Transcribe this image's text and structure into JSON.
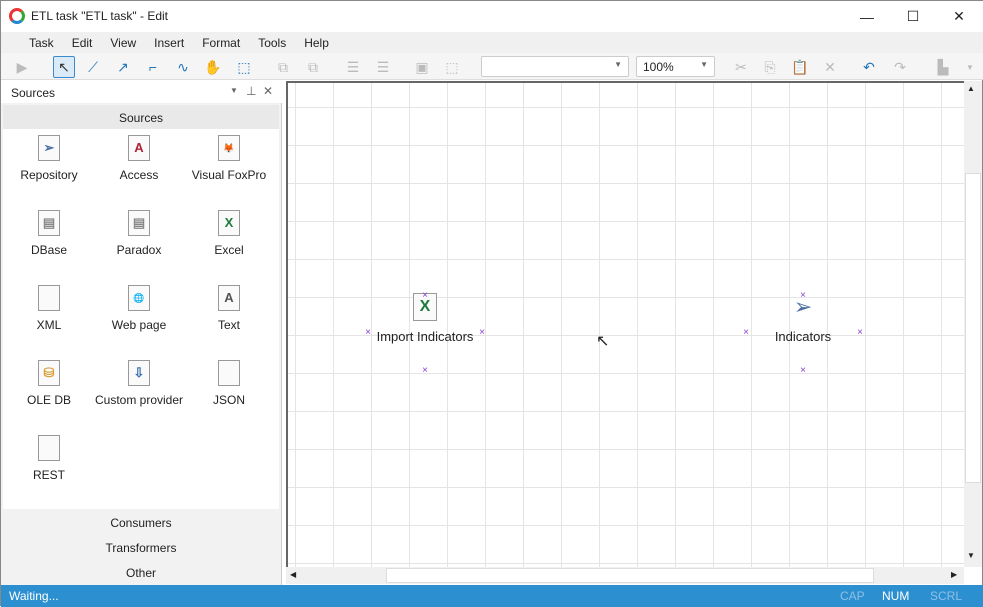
{
  "window": {
    "title": "ETL task \"ETL task\" - Edit",
    "minimize": "—",
    "maximize": "☐",
    "close": "✕"
  },
  "menu": [
    "Task",
    "Edit",
    "View",
    "Insert",
    "Format",
    "Tools",
    "Help"
  ],
  "toolbar": {
    "zoom": "100%",
    "font_combo": ""
  },
  "panel": {
    "title": "Sources",
    "section": "Sources",
    "items": [
      {
        "label": "Repository",
        "icon": "paper-plane-icon"
      },
      {
        "label": "Access",
        "icon": "access-icon"
      },
      {
        "label": "Visual FoxPro",
        "icon": "foxpro-icon"
      },
      {
        "label": "DBase",
        "icon": "database-file-icon"
      },
      {
        "label": "Paradox",
        "icon": "database-file-icon"
      },
      {
        "label": "Excel",
        "icon": "excel-icon"
      },
      {
        "label": "XML",
        "icon": "code-file-icon"
      },
      {
        "label": "Web page",
        "icon": "globe-file-icon"
      },
      {
        "label": "Text",
        "icon": "text-file-icon"
      },
      {
        "label": "OLE DB",
        "icon": "cylinder-icon"
      },
      {
        "label": "Custom provider",
        "icon": "custom-provider-icon"
      },
      {
        "label": "JSON",
        "icon": "code-file-icon"
      },
      {
        "label": "REST",
        "icon": "code-file-icon"
      }
    ],
    "categories": [
      "Consumers",
      "Transformers",
      "Other"
    ]
  },
  "canvas": {
    "nodes": [
      {
        "label": "Import Indicators",
        "icon": "excel-icon"
      },
      {
        "label": "Indicators",
        "icon": "paper-plane-icon"
      }
    ]
  },
  "status": {
    "text": "Waiting...",
    "cap": "CAP",
    "num": "NUM",
    "scrl": "SCRL"
  },
  "colors": {
    "accent": "#2b8fd0",
    "selection": "#8a3fd1"
  }
}
